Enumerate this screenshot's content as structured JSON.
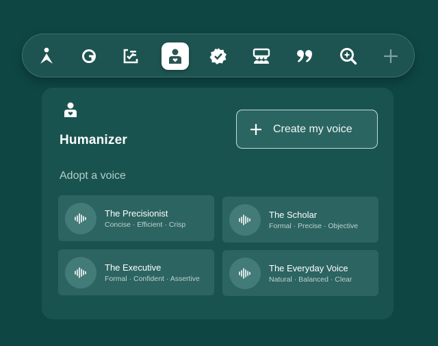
{
  "toolbar": {
    "items": [
      {
        "icon": "person-a-icon",
        "active": false
      },
      {
        "icon": "grammarly-g-icon",
        "active": false
      },
      {
        "icon": "rewrite-icon",
        "active": false
      },
      {
        "icon": "humanizer-icon",
        "active": true
      },
      {
        "icon": "verified-badge-icon",
        "active": false
      },
      {
        "icon": "audience-icon",
        "active": false
      },
      {
        "icon": "quote-icon",
        "active": false
      },
      {
        "icon": "ai-search-icon",
        "active": false
      },
      {
        "icon": "add-icon",
        "active": false
      }
    ]
  },
  "panel": {
    "title": "Humanizer",
    "create_button": "Create my voice",
    "section_label": "Adopt a voice",
    "voices": [
      {
        "name": "The Precisionist",
        "tags": "Concise · Efficient · Crisp"
      },
      {
        "name": "The Scholar",
        "tags": "Formal · Precise · Objective"
      },
      {
        "name": "The Executive",
        "tags": "Formal · Confident · Assertive"
      },
      {
        "name": "The Everyday Voice",
        "tags": "Natural · Balanced · Clear"
      }
    ]
  },
  "colors": {
    "background": "#0e4643",
    "panel": "#195350",
    "card": "#2c6461",
    "active_icon": "#2a5552"
  }
}
